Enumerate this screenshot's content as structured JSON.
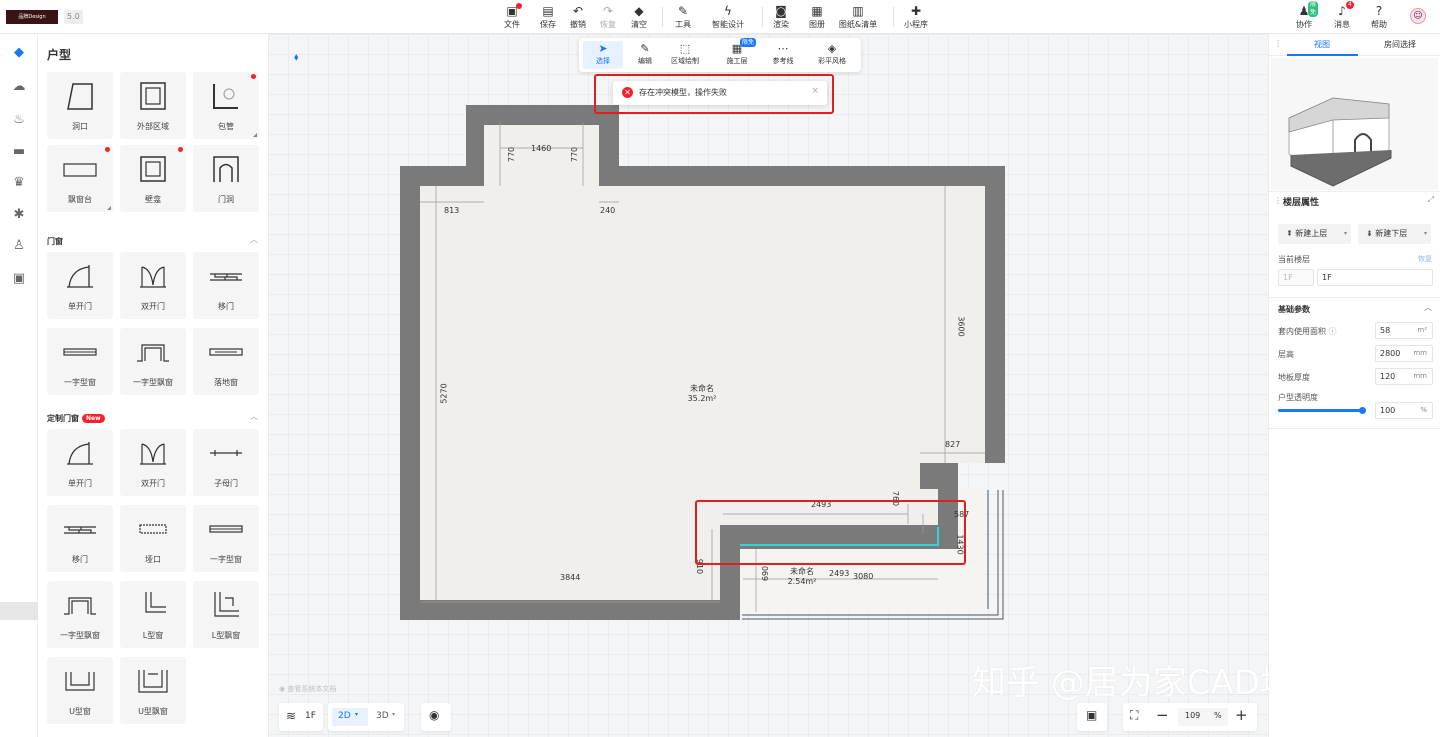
{
  "app": {
    "logo": "品牌Design",
    "version": "5.0"
  },
  "topbar": {
    "tools": [
      {
        "label": "文件",
        "icon": "file-icon"
      },
      {
        "label": "保存",
        "icon": "save-icon"
      },
      {
        "label": "撤销",
        "icon": "undo-icon"
      },
      {
        "label": "恢复",
        "icon": "redo-icon"
      },
      {
        "label": "清空",
        "icon": "eraser-icon"
      },
      {
        "label": "工具",
        "icon": "wrench-icon"
      },
      {
        "label": "智能设计",
        "icon": "lightning-icon"
      },
      {
        "label": "渲染",
        "icon": "camera-icon"
      },
      {
        "label": "图册",
        "icon": "album-icon"
      },
      {
        "label": "图纸&清单",
        "icon": "drawing-list-icon"
      },
      {
        "label": "小程序",
        "icon": "puzzle-icon"
      }
    ],
    "right": [
      {
        "label": "协作",
        "badge": "限免"
      },
      {
        "label": "消息",
        "badge": "4"
      },
      {
        "label": "帮助",
        "badge": ""
      }
    ]
  },
  "library": {
    "title": "户型",
    "section_door": "门窗",
    "section_custom": "定制门窗",
    "new_badge": "New",
    "layout_items": [
      "洞口",
      "外部区域",
      "包管",
      "飘窗台",
      "壁龛",
      "门洞"
    ],
    "door_items": [
      "单开门",
      "双开门",
      "移门",
      "一字型窗",
      "一字型飘窗",
      "落地窗"
    ],
    "custom_items": [
      "单开门",
      "双开门",
      "子母门",
      "移门",
      "垭口",
      "一字型窗",
      "一字型飘窗",
      "L型窗",
      "L型飘窗",
      "U型窗",
      "U型飘窗"
    ]
  },
  "canvas_toolbar": {
    "items": [
      {
        "label": "选择",
        "icon": "cursor-icon"
      },
      {
        "label": "编辑",
        "icon": "edit-icon"
      },
      {
        "label": "区域绘制",
        "icon": "area-draw-icon"
      },
      {
        "label": "施工层",
        "icon": "construction-icon",
        "badge": "限免"
      },
      {
        "label": "参考线",
        "icon": "guide-icon"
      },
      {
        "label": "彩平风格",
        "icon": "paint-icon"
      }
    ]
  },
  "toast": {
    "message": "存在冲突模型，操作失败",
    "close": "×"
  },
  "plan": {
    "dims": {
      "d1460": "1460",
      "d770a": "770",
      "d770b": "770",
      "d813": "813",
      "d240": "240",
      "d3600": "3600",
      "d5270": "5270",
      "d827": "827",
      "d760": "760",
      "d2493a": "2493",
      "d587": "587",
      "d1430": "1430",
      "d910": "910",
      "d3844": "3844",
      "d690": "690",
      "d2493b": "2493",
      "d3080": "3080"
    },
    "room1": {
      "name": "未命名",
      "area": "35.2m²"
    },
    "room2": {
      "name": "未命名",
      "area": "2.54m²"
    }
  },
  "bottombar": {
    "floor": "1F",
    "mode2d": "2D",
    "mode3d": "3D",
    "zoom": "109",
    "zoom_unit": "%",
    "hint": "查看系统本文档"
  },
  "watermark": "知乎 @居为家CAD培训",
  "right_panel": {
    "tabs": [
      "视图",
      "房间选择"
    ],
    "floor_props": "楼层属性",
    "new_upper": "新建上层",
    "new_lower": "新建下层",
    "current_floor_label": "当前楼层",
    "restore": "恢复",
    "floor_code": "1F",
    "floor_name": "1F",
    "basic_params": "基础参数",
    "params": [
      {
        "label": "套内使用面积",
        "value": "58",
        "unit": "m²"
      },
      {
        "label": "层高",
        "value": "2800",
        "unit": "mm"
      },
      {
        "label": "地板厚度",
        "value": "120",
        "unit": "mm"
      }
    ],
    "opacity_label": "户型透明度",
    "opacity_value": "100",
    "opacity_unit": "%",
    "opacity_level": 1.0
  },
  "colors": {
    "accent": "#1677ff",
    "wall": "#7a7a7a",
    "floor": "#f1efec",
    "error": "#e02020"
  }
}
